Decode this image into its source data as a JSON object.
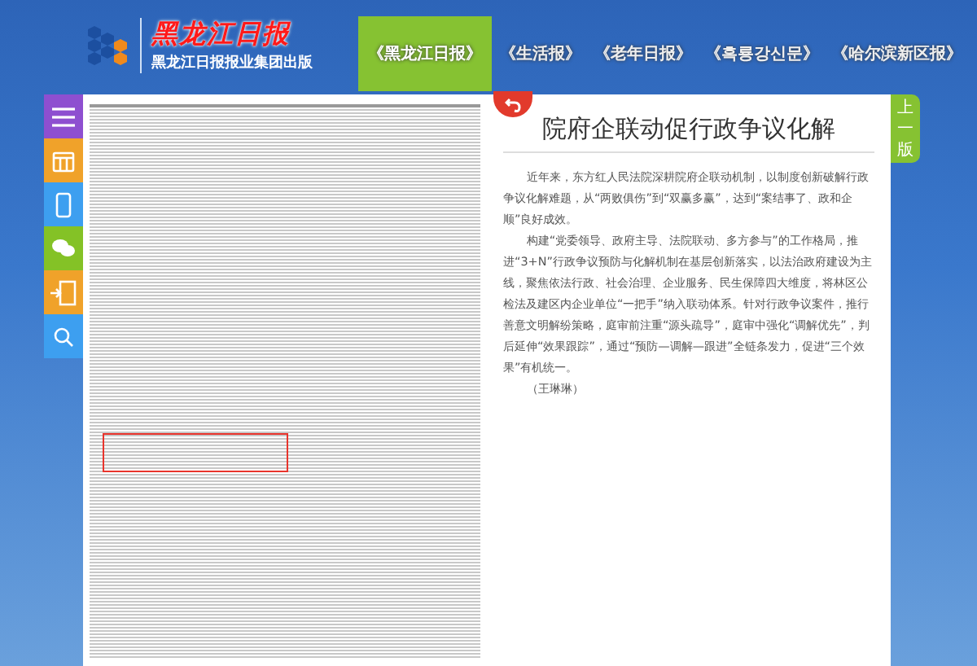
{
  "header": {
    "logo_title": "黑龙江日报",
    "publisher": "黑龙江日报报业集团出版"
  },
  "nav_tabs": [
    {
      "label": "《黑龙江日报》",
      "selected": true
    },
    {
      "label": "《生活报》",
      "selected": false
    },
    {
      "label": "《老年日报》",
      "selected": false
    },
    {
      "label": "《흑룡강신문》",
      "selected": false
    },
    {
      "label": "《哈尔滨新区报》",
      "selected": false
    }
  ],
  "side_tools": [
    {
      "kind": "menu",
      "color": "#8e4fd0"
    },
    {
      "kind": "calendar",
      "color": "#f0a22a"
    },
    {
      "kind": "phone",
      "color": "#3d9ff0"
    },
    {
      "kind": "wechat",
      "color": "#84c226"
    },
    {
      "kind": "download",
      "color": "#f0a22a"
    },
    {
      "kind": "search",
      "color": "#3d9ff0"
    }
  ],
  "article": {
    "title": "院府企联动促行政争议化解",
    "paragraphs": [
      "近年来，东方红人民法院深耕院府企联动机制，以制度创新破解行政争议化解难题，从“两败俱伤”到“双赢多赢”，达到“案结事了、政和企顺”良好成效。",
      "构建“党委领导、政府主导、法院联动、多方参与”的工作格局，推进“3+N”行政争议预防与化解机制在基层创新落实，以法治政府建设为主线，聚焦依法行政、社会治理、企业服务、民生保障四大维度，将林区公检法及建区内企业单位“一把手”纳入联动体系。针对行政争议案件，推行善意文明解纷策略，庭审前注重“源头疏导”，庭审中强化“调解优先”，判后延伸“效果跟踪”，通过“预防—调解—跟进”全链条发力，促进“三个效果”有机统一。",
      "（王琳琳）"
    ]
  },
  "prev_page": "上一版"
}
